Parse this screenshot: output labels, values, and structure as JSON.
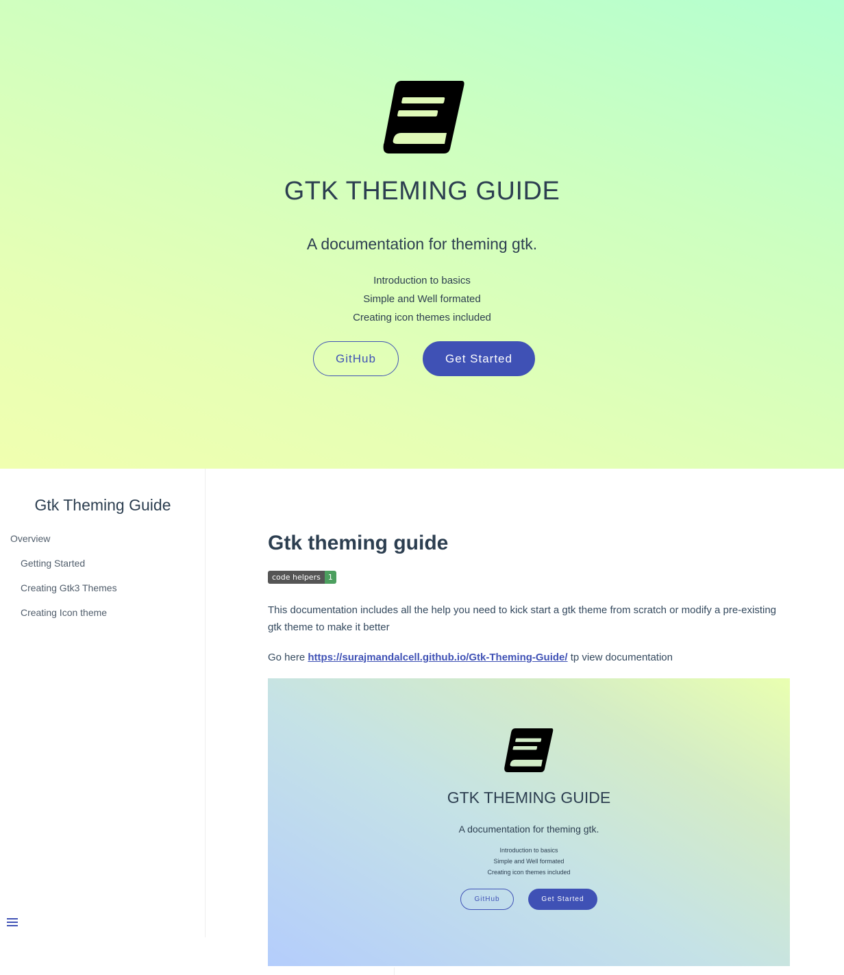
{
  "cover": {
    "logo_icon": "book-icon",
    "title": "GTK THEMING GUIDE",
    "tagline": "A documentation for theming gtk.",
    "features": [
      "Introduction to basics",
      "Simple and Well formated",
      "Creating icon themes included"
    ],
    "github_label": "GitHub",
    "get_started_label": "Get Started"
  },
  "sidebar": {
    "title": "Gtk Theming Guide",
    "items": [
      {
        "label": "Overview"
      },
      {
        "label": "Getting Started"
      },
      {
        "label": "Creating Gtk3 Themes"
      },
      {
        "label": "Creating Icon theme"
      }
    ],
    "menu_icon": "hamburger-menu-icon"
  },
  "content": {
    "title": "Gtk theming guide",
    "badge_left": "code helpers",
    "badge_right": "1",
    "paragraph1": "This documentation includes all the help you need to kick start a gtk theme from scratch or modify a pre-existing gtk theme to make it better",
    "go_here_prefix": "Go here ",
    "link_text": "https://surajmandalcell.github.io/Gtk-Theming-Guide/",
    "go_here_suffix": " tp view documentation"
  },
  "preview": {
    "title": "GTK THEMING GUIDE",
    "tagline": "A documentation for theming gtk.",
    "features": [
      "Introduction to basics",
      "Simple and Well formated",
      "Creating icon themes included"
    ],
    "github_label": "GitHub",
    "get_started_label": "Get Started"
  },
  "colors": {
    "accent": "#3f51b5",
    "text": "#34495e",
    "heading": "#2c3e50"
  }
}
